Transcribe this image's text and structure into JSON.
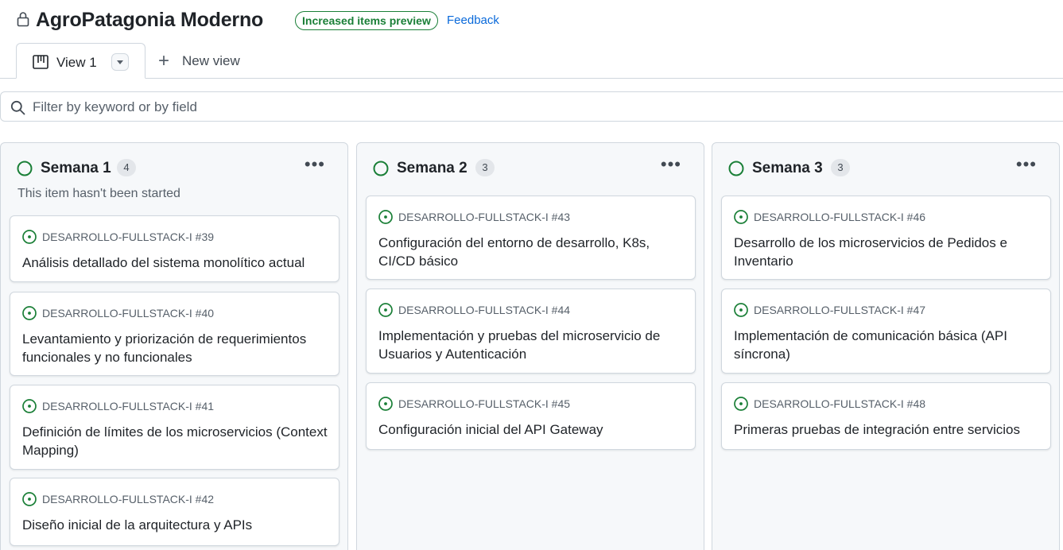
{
  "header": {
    "title": "AgroPatagonia Moderno",
    "badge": "Increased items preview",
    "feedback": "Feedback"
  },
  "tabs": {
    "active_label": "View 1",
    "new_view_label": "New view"
  },
  "filter": {
    "placeholder": "Filter by keyword or by field"
  },
  "colors": {
    "status_green": "#1a7f37",
    "link_blue": "#0969da"
  },
  "columns": [
    {
      "title": "Semana 1",
      "count": "4",
      "description": "This item hasn't been started",
      "cards": [
        {
          "repo": "DESARROLLO-FULLSTACK-I #39",
          "title": "Análisis detallado del sistema monolítico actual"
        },
        {
          "repo": "DESARROLLO-FULLSTACK-I #40",
          "title": "Levantamiento y priorización de requerimientos funcionales y no funcionales"
        },
        {
          "repo": "DESARROLLO-FULLSTACK-I #41",
          "title": "Definición de límites de los microservicios (Context Mapping)"
        },
        {
          "repo": "DESARROLLO-FULLSTACK-I #42",
          "title": "Diseño inicial de la arquitectura y APIs"
        }
      ]
    },
    {
      "title": "Semana 2",
      "count": "3",
      "cards": [
        {
          "repo": "DESARROLLO-FULLSTACK-I #43",
          "title": "Configuración del entorno de desarrollo, K8s, CI/CD básico"
        },
        {
          "repo": "DESARROLLO-FULLSTACK-I #44",
          "title": "Implementación y pruebas del microservicio de Usuarios y Autenticación"
        },
        {
          "repo": "DESARROLLO-FULLSTACK-I #45",
          "title": "Configuración inicial del API Gateway"
        }
      ]
    },
    {
      "title": "Semana 3",
      "count": "3",
      "cards": [
        {
          "repo": "DESARROLLO-FULLSTACK-I #46",
          "title": "Desarrollo de los microservicios de Pedidos e Inventario"
        },
        {
          "repo": "DESARROLLO-FULLSTACK-I #47",
          "title": "Implementación de comunicación básica (API síncrona)"
        },
        {
          "repo": "DESARROLLO-FULLSTACK-I #48",
          "title": "Primeras pruebas de integración entre servicios"
        }
      ]
    }
  ]
}
